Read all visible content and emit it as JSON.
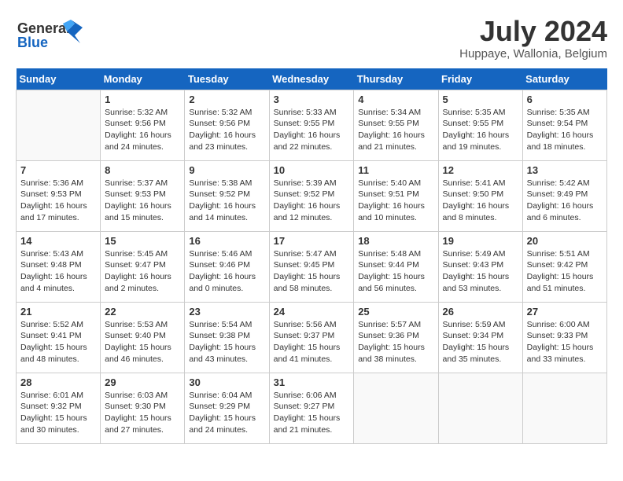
{
  "header": {
    "logo_general": "General",
    "logo_blue": "Blue",
    "month_title": "July 2024",
    "location": "Huppaye, Wallonia, Belgium"
  },
  "calendar": {
    "weekdays": [
      "Sunday",
      "Monday",
      "Tuesday",
      "Wednesday",
      "Thursday",
      "Friday",
      "Saturday"
    ],
    "weeks": [
      [
        {
          "day": "",
          "empty": true
        },
        {
          "day": "1",
          "sunrise": "Sunrise: 5:32 AM",
          "sunset": "Sunset: 9:56 PM",
          "daylight": "Daylight: 16 hours and 24 minutes."
        },
        {
          "day": "2",
          "sunrise": "Sunrise: 5:32 AM",
          "sunset": "Sunset: 9:56 PM",
          "daylight": "Daylight: 16 hours and 23 minutes."
        },
        {
          "day": "3",
          "sunrise": "Sunrise: 5:33 AM",
          "sunset": "Sunset: 9:55 PM",
          "daylight": "Daylight: 16 hours and 22 minutes."
        },
        {
          "day": "4",
          "sunrise": "Sunrise: 5:34 AM",
          "sunset": "Sunset: 9:55 PM",
          "daylight": "Daylight: 16 hours and 21 minutes."
        },
        {
          "day": "5",
          "sunrise": "Sunrise: 5:35 AM",
          "sunset": "Sunset: 9:55 PM",
          "daylight": "Daylight: 16 hours and 19 minutes."
        },
        {
          "day": "6",
          "sunrise": "Sunrise: 5:35 AM",
          "sunset": "Sunset: 9:54 PM",
          "daylight": "Daylight: 16 hours and 18 minutes."
        }
      ],
      [
        {
          "day": "7",
          "sunrise": "Sunrise: 5:36 AM",
          "sunset": "Sunset: 9:53 PM",
          "daylight": "Daylight: 16 hours and 17 minutes."
        },
        {
          "day": "8",
          "sunrise": "Sunrise: 5:37 AM",
          "sunset": "Sunset: 9:53 PM",
          "daylight": "Daylight: 16 hours and 15 minutes."
        },
        {
          "day": "9",
          "sunrise": "Sunrise: 5:38 AM",
          "sunset": "Sunset: 9:52 PM",
          "daylight": "Daylight: 16 hours and 14 minutes."
        },
        {
          "day": "10",
          "sunrise": "Sunrise: 5:39 AM",
          "sunset": "Sunset: 9:52 PM",
          "daylight": "Daylight: 16 hours and 12 minutes."
        },
        {
          "day": "11",
          "sunrise": "Sunrise: 5:40 AM",
          "sunset": "Sunset: 9:51 PM",
          "daylight": "Daylight: 16 hours and 10 minutes."
        },
        {
          "day": "12",
          "sunrise": "Sunrise: 5:41 AM",
          "sunset": "Sunset: 9:50 PM",
          "daylight": "Daylight: 16 hours and 8 minutes."
        },
        {
          "day": "13",
          "sunrise": "Sunrise: 5:42 AM",
          "sunset": "Sunset: 9:49 PM",
          "daylight": "Daylight: 16 hours and 6 minutes."
        }
      ],
      [
        {
          "day": "14",
          "sunrise": "Sunrise: 5:43 AM",
          "sunset": "Sunset: 9:48 PM",
          "daylight": "Daylight: 16 hours and 4 minutes."
        },
        {
          "day": "15",
          "sunrise": "Sunrise: 5:45 AM",
          "sunset": "Sunset: 9:47 PM",
          "daylight": "Daylight: 16 hours and 2 minutes."
        },
        {
          "day": "16",
          "sunrise": "Sunrise: 5:46 AM",
          "sunset": "Sunset: 9:46 PM",
          "daylight": "Daylight: 16 hours and 0 minutes."
        },
        {
          "day": "17",
          "sunrise": "Sunrise: 5:47 AM",
          "sunset": "Sunset: 9:45 PM",
          "daylight": "Daylight: 15 hours and 58 minutes."
        },
        {
          "day": "18",
          "sunrise": "Sunrise: 5:48 AM",
          "sunset": "Sunset: 9:44 PM",
          "daylight": "Daylight: 15 hours and 56 minutes."
        },
        {
          "day": "19",
          "sunrise": "Sunrise: 5:49 AM",
          "sunset": "Sunset: 9:43 PM",
          "daylight": "Daylight: 15 hours and 53 minutes."
        },
        {
          "day": "20",
          "sunrise": "Sunrise: 5:51 AM",
          "sunset": "Sunset: 9:42 PM",
          "daylight": "Daylight: 15 hours and 51 minutes."
        }
      ],
      [
        {
          "day": "21",
          "sunrise": "Sunrise: 5:52 AM",
          "sunset": "Sunset: 9:41 PM",
          "daylight": "Daylight: 15 hours and 48 minutes."
        },
        {
          "day": "22",
          "sunrise": "Sunrise: 5:53 AM",
          "sunset": "Sunset: 9:40 PM",
          "daylight": "Daylight: 15 hours and 46 minutes."
        },
        {
          "day": "23",
          "sunrise": "Sunrise: 5:54 AM",
          "sunset": "Sunset: 9:38 PM",
          "daylight": "Daylight: 15 hours and 43 minutes."
        },
        {
          "day": "24",
          "sunrise": "Sunrise: 5:56 AM",
          "sunset": "Sunset: 9:37 PM",
          "daylight": "Daylight: 15 hours and 41 minutes."
        },
        {
          "day": "25",
          "sunrise": "Sunrise: 5:57 AM",
          "sunset": "Sunset: 9:36 PM",
          "daylight": "Daylight: 15 hours and 38 minutes."
        },
        {
          "day": "26",
          "sunrise": "Sunrise: 5:59 AM",
          "sunset": "Sunset: 9:34 PM",
          "daylight": "Daylight: 15 hours and 35 minutes."
        },
        {
          "day": "27",
          "sunrise": "Sunrise: 6:00 AM",
          "sunset": "Sunset: 9:33 PM",
          "daylight": "Daylight: 15 hours and 33 minutes."
        }
      ],
      [
        {
          "day": "28",
          "sunrise": "Sunrise: 6:01 AM",
          "sunset": "Sunset: 9:32 PM",
          "daylight": "Daylight: 15 hours and 30 minutes."
        },
        {
          "day": "29",
          "sunrise": "Sunrise: 6:03 AM",
          "sunset": "Sunset: 9:30 PM",
          "daylight": "Daylight: 15 hours and 27 minutes."
        },
        {
          "day": "30",
          "sunrise": "Sunrise: 6:04 AM",
          "sunset": "Sunset: 9:29 PM",
          "daylight": "Daylight: 15 hours and 24 minutes."
        },
        {
          "day": "31",
          "sunrise": "Sunrise: 6:06 AM",
          "sunset": "Sunset: 9:27 PM",
          "daylight": "Daylight: 15 hours and 21 minutes."
        },
        {
          "day": "",
          "empty": true
        },
        {
          "day": "",
          "empty": true
        },
        {
          "day": "",
          "empty": true
        }
      ]
    ]
  }
}
